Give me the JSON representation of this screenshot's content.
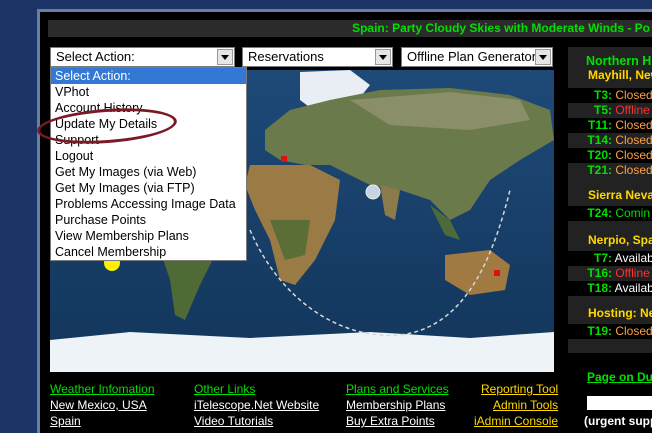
{
  "ticker": "Spain: Party Cloudy Skies with Moderate Winds - Po",
  "selects": {
    "action": "Select Action:",
    "reservations": "Reservations",
    "offline": "Offline Plan Generator"
  },
  "action_menu": [
    "Select Action:",
    "VPhot",
    "Account History",
    "Update My Details",
    "Support",
    "Logout",
    "Get My Images (via Web)",
    "Get My Images (via FTP)",
    "Problems Accessing Image Data",
    "Purchase Points",
    "View Membership Plans",
    "Cancel Membership"
  ],
  "side": {
    "header": "Northern H",
    "site1": "Mayhill, New",
    "site1_rows": [
      {
        "k": "T3:",
        "v": "Closed",
        "c": "amber"
      },
      {
        "k": "T5:",
        "v": "Offline",
        "c": "red"
      },
      {
        "k": "T11:",
        "v": "Closed",
        "c": "amber"
      },
      {
        "k": "T14:",
        "v": "Closed",
        "c": "amber"
      },
      {
        "k": "T20:",
        "v": "Closed",
        "c": "amber"
      },
      {
        "k": "T21:",
        "v": "Closed",
        "c": "amber"
      }
    ],
    "site2": "Sierra Neva",
    "site2_rows": [
      {
        "k": "T24:",
        "v": "Comin",
        "c": "grn"
      }
    ],
    "site3": "Nerpio, Spa",
    "site3_rows": [
      {
        "k": "T7:",
        "v": "Availab",
        "c": "wh"
      },
      {
        "k": "T16:",
        "v": "Offline",
        "c": "red"
      },
      {
        "k": "T18:",
        "v": "Availab",
        "c": "wh"
      }
    ],
    "site4": "Hosting: Nev",
    "site4_rows": [
      {
        "k": "T19:",
        "v": "Closed",
        "c": "amber"
      }
    ]
  },
  "footer": {
    "col1": [
      "Weather Infomation",
      "New Mexico, USA",
      "Spain"
    ],
    "col2": [
      "Other Links",
      "iTelescope.Net Website",
      "Video Tutorials"
    ],
    "col3": [
      "Plans and Services",
      "Membership Plans",
      "Buy Extra Points"
    ],
    "col4": [
      "Reporting Tool",
      "Admin Tools",
      "iAdmin Console"
    ]
  },
  "page_on_duty": "Page on Du",
  "urgent": "(urgent supp"
}
